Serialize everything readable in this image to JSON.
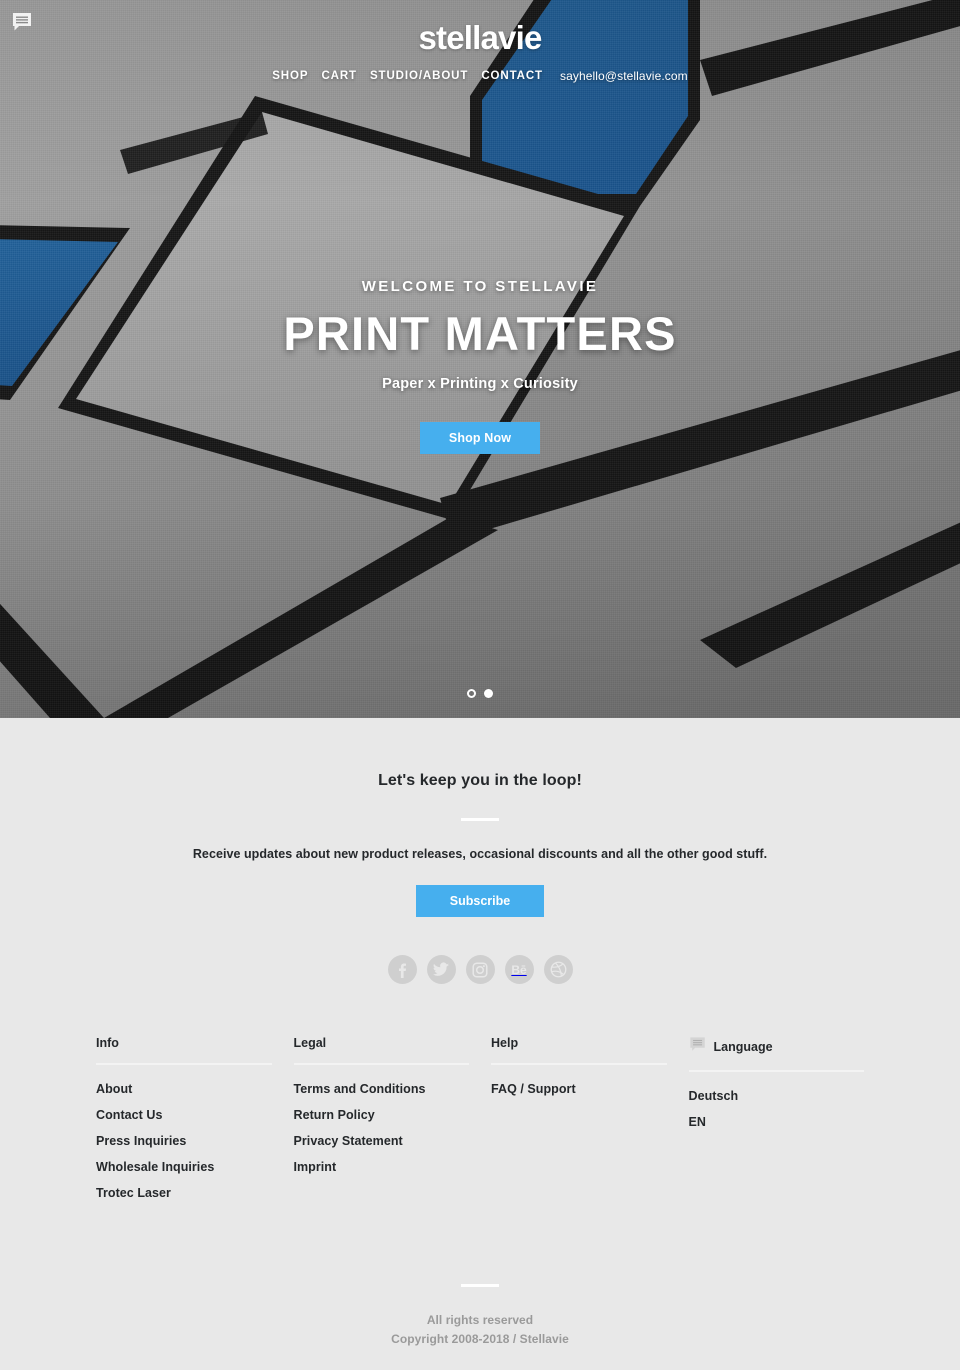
{
  "chat_badge": {
    "icon": "chat-bubble-icon"
  },
  "header": {
    "brand": "stellavie",
    "nav": [
      {
        "label": "SHOP",
        "type": "link"
      },
      {
        "label": "CART",
        "type": "link"
      },
      {
        "label": "STUDIO/ABOUT",
        "type": "link"
      },
      {
        "label": "CONTACT",
        "type": "link"
      },
      {
        "label": "sayhello@stellavie.com",
        "type": "email"
      }
    ]
  },
  "hero": {
    "eyebrow": "WELCOME TO STELLAVIE",
    "headline": "PRINT MATTERS",
    "subhead": "Paper x Printing x Curiosity",
    "cta_label": "Shop Now",
    "slides": [
      {
        "state": "inactive"
      },
      {
        "state": "active"
      }
    ],
    "colors": {
      "paper_gray": "#999999",
      "band_black": "#161616",
      "accent_blue": "#1f5f9e",
      "button_blue": "#46afee"
    }
  },
  "newsletter": {
    "title": "Let's keep you in the loop!",
    "text": "Receive updates about new product releases, occasional discounts and all the other good stuff.",
    "button_label": "Subscribe",
    "socials": [
      {
        "name": "facebook",
        "glyph": "f"
      },
      {
        "name": "twitter",
        "glyph": ""
      },
      {
        "name": "instagram",
        "glyph": ""
      },
      {
        "name": "behance",
        "glyph": "Bē"
      },
      {
        "name": "dribbble",
        "glyph": ""
      }
    ]
  },
  "footer": {
    "columns": [
      {
        "heading": "Info",
        "icon": null,
        "links": [
          "About",
          "Contact Us",
          "Press Inquiries",
          "Wholesale Inquiries",
          "Trotec Laser"
        ]
      },
      {
        "heading": "Legal",
        "icon": null,
        "links": [
          "Terms and Conditions",
          "Return Policy",
          "Privacy Statement",
          "Imprint"
        ]
      },
      {
        "heading": "Help",
        "icon": null,
        "links": [
          "FAQ / Support"
        ]
      },
      {
        "heading": "Language",
        "icon": "speech-bubble-icon",
        "links": [
          "Deutsch",
          "EN"
        ]
      }
    ],
    "copyright_line1": "All rights reserved",
    "copyright_line2": "Copyright 2008-2018 / Stellavie"
  }
}
